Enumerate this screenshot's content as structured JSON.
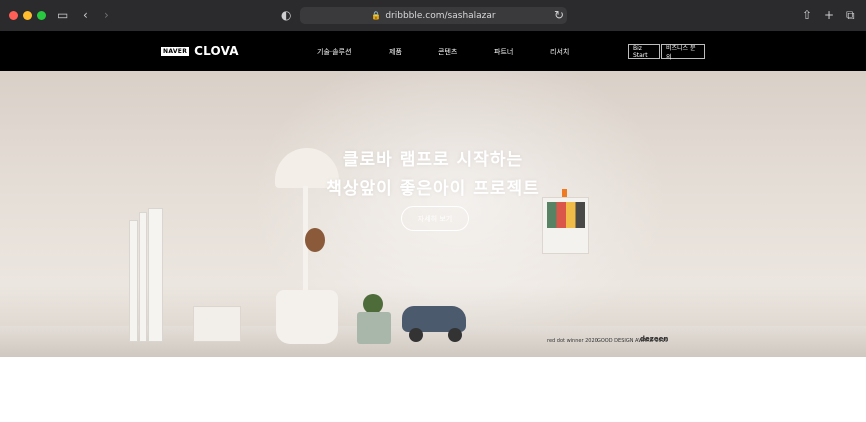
{
  "browser": {
    "url": "dribbble.com/sashalazar",
    "icons": [
      "sidebar-icon",
      "back-icon",
      "forward-icon",
      "shield-icon",
      "lock-icon",
      "reload-icon",
      "share-icon",
      "new-tab-icon",
      "tabs-icon"
    ]
  },
  "header": {
    "logo_naver": "NAVER",
    "logo_clova": "CLOVA",
    "nav": [
      "기술·솔루션",
      "제품",
      "콘텐츠",
      "파트너",
      "리서치"
    ],
    "buttons": [
      "Biz Start",
      "비즈니스 문의"
    ]
  },
  "hero": {
    "title_line1": "클로바 램프로 시작하는",
    "title_line2": "책상앞이 좋은아이 프로젝트",
    "cta": "자세히 보기",
    "awards": [
      "red dot winner 2020",
      "GOOD DESIGN AWARD 2019",
      "dezeen"
    ]
  },
  "colors": {
    "chrome": "#2b2b2d",
    "header_bg": "#000000",
    "hero_bg": "#e6dfd8",
    "accent_orange": "#ef7a22"
  }
}
